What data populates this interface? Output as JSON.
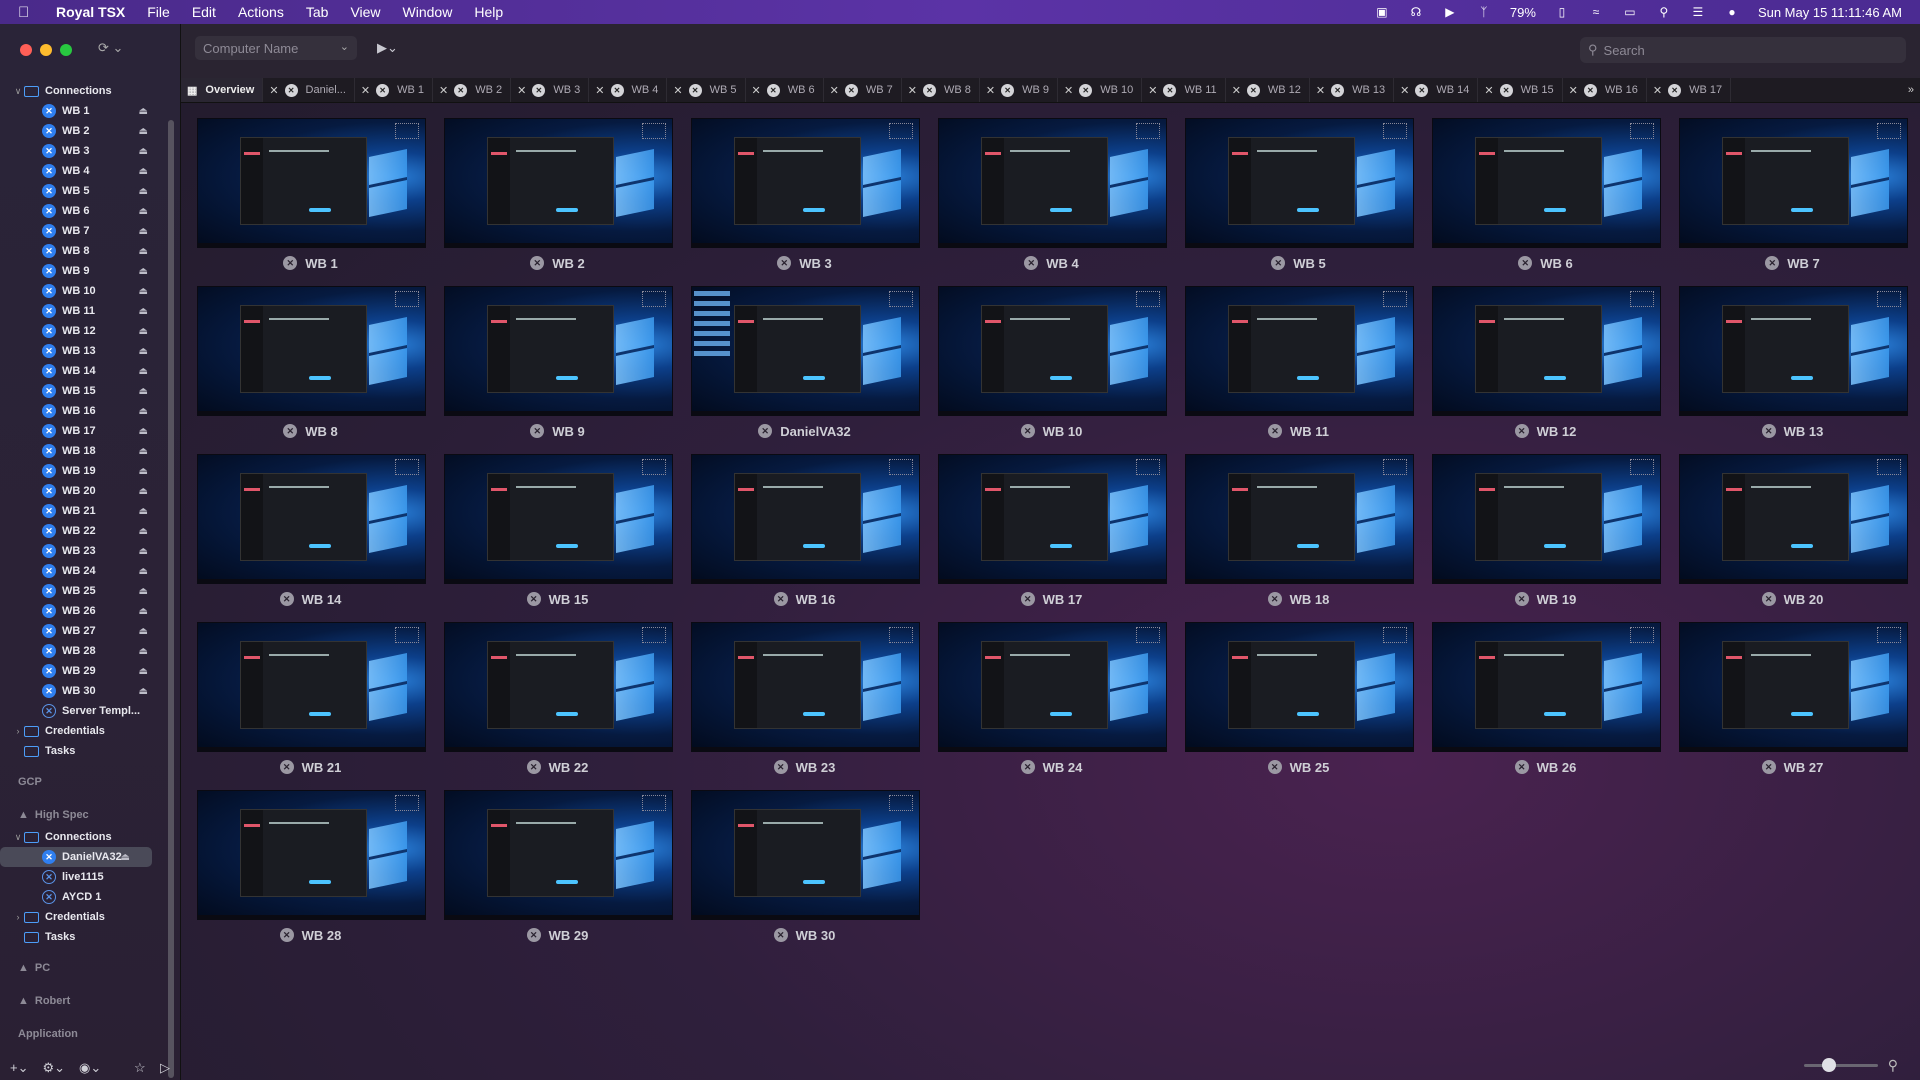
{
  "menubar": {
    "app_name": "Royal TSX",
    "menus": [
      "File",
      "Edit",
      "Actions",
      "Tab",
      "View",
      "Window",
      "Help"
    ],
    "battery": "79%",
    "datetime": "Sun May 15  11:11:46 AM"
  },
  "toolbar": {
    "computer_name_placeholder": "Computer Name",
    "search_placeholder": "Search"
  },
  "sidebar": {
    "connections_label": "Connections",
    "items": [
      "WB 1",
      "WB 2",
      "WB 3",
      "WB 4",
      "WB 5",
      "WB 6",
      "WB 7",
      "WB 8",
      "WB 9",
      "WB 10",
      "WB 11",
      "WB 12",
      "WB 13",
      "WB 14",
      "WB 15",
      "WB 16",
      "WB 17",
      "WB 18",
      "WB 19",
      "WB 20",
      "WB 21",
      "WB 22",
      "WB 23",
      "WB 24",
      "WB 25",
      "WB 26",
      "WB 27",
      "WB 28",
      "WB 29",
      "WB 30"
    ],
    "server_templates": "Server Templ...",
    "credentials": "Credentials",
    "tasks": "Tasks",
    "gcp": "GCP",
    "high_spec": "High Spec",
    "hs_connections": "Connections",
    "hs_items": [
      "DanielVA32",
      "live1115",
      "AYCD 1"
    ],
    "hs_credentials": "Credentials",
    "hs_tasks": "Tasks",
    "pc": "PC",
    "robert": "Robert",
    "application": "Application"
  },
  "tabs": {
    "overview": "Overview",
    "items": [
      "Daniel...",
      "WB 1",
      "WB 2",
      "WB 3",
      "WB 4",
      "WB 5",
      "WB 6",
      "WB 7",
      "WB 8",
      "WB 9",
      "WB 10",
      "WB 11",
      "WB 12",
      "WB 13",
      "WB 14",
      "WB 15",
      "WB 16",
      "WB 17"
    ]
  },
  "tiles": [
    "WB 1",
    "WB 2",
    "WB 3",
    "WB 4",
    "WB 5",
    "WB 6",
    "WB 7",
    "WB 8",
    "WB 9",
    "DanielVA32",
    "WB 10",
    "WB 11",
    "WB 12",
    "WB 13",
    "WB 14",
    "WB 15",
    "WB 16",
    "WB 17",
    "WB 18",
    "WB 19",
    "WB 20",
    "WB 21",
    "WB 22",
    "WB 23",
    "WB 24",
    "WB 25",
    "WB 26",
    "WB 27",
    "WB 28",
    "WB 29",
    "WB 30"
  ],
  "zoom_level": 0.3,
  "colors": {
    "accent": "#2f7ff0",
    "menubar": "#5b33a6"
  }
}
